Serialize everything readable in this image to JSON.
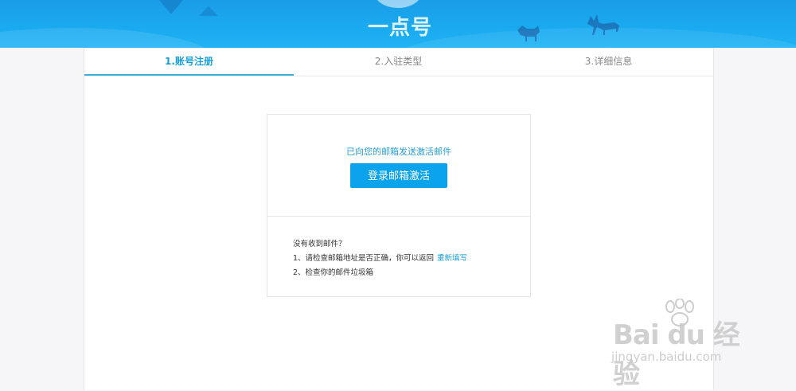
{
  "banner": {
    "logo_text": "一点号"
  },
  "steps": [
    {
      "label": "1.账号注册",
      "active": true
    },
    {
      "label": "2.入驻类型",
      "active": false
    },
    {
      "label": "3.详细信息",
      "active": false
    }
  ],
  "activation": {
    "notice": "已向您的邮箱发送激活邮件",
    "button_label": "登录邮箱激活"
  },
  "help": {
    "title": "没有收到邮件？",
    "item1_text": "1、请检查邮箱地址是否正确，你可以返回",
    "item1_link": "重新填写",
    "item2_text": "2、检查你的邮件垃圾箱"
  },
  "watermark": {
    "brand": "Bai du 经验",
    "url": "jingyan.baidu.com"
  },
  "colors": {
    "banner": "#1aaaf0",
    "accent": "#1a9fd8",
    "button": "#0aa3ec"
  }
}
